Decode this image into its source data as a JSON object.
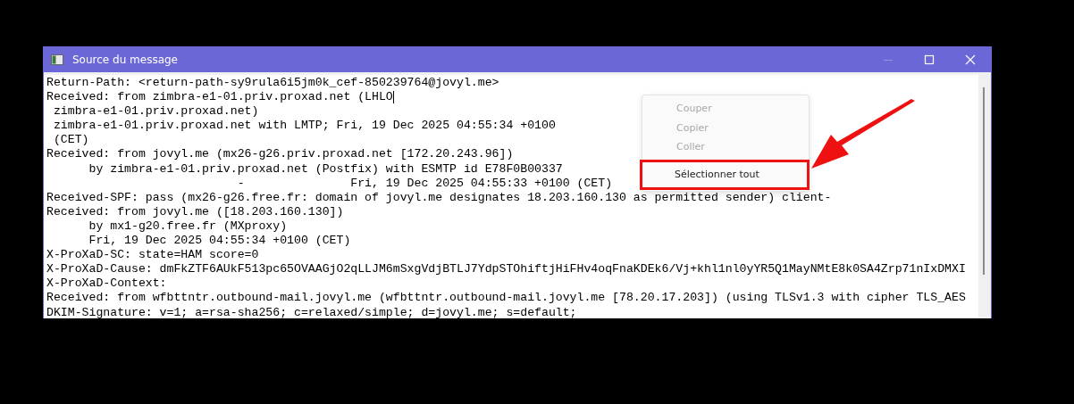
{
  "window": {
    "title": "Source du message"
  },
  "lines": [
    {
      "text": "Return-Path: <return-path-sy9rula6i5jm0k_cef-850239764@jovyl.me>",
      "caret": false
    },
    {
      "text": "Received: from zimbra-e1-01.priv.proxad.net (LHLO",
      "caret": true
    },
    {
      "text": " zimbra-e1-01.priv.proxad.net)",
      "caret": false
    },
    {
      "text": " zimbra-e1-01.priv.proxad.net with LMTP; Fri, 19 Dec 2025 04:55:34 +0100",
      "caret": false
    },
    {
      "text": " (CET)",
      "caret": false
    },
    {
      "text": "Received: from jovyl.me (mx26-g26.priv.proxad.net [172.20.243.96])",
      "caret": false
    },
    {
      "text": "      by zimbra-e1-01.priv.proxad.net (Postfix) with ESMTP id E78F0B00337",
      "caret": false
    },
    {
      "text": "                           -               Fri, 19 Dec 2025 04:55:33 +0100 (CET)",
      "caret": false
    },
    {
      "text": "Received-SPF: pass (mx26-g26.free.fr: domain of jovyl.me designates 18.203.160.130 as permitted sender) client-",
      "caret": false
    },
    {
      "text": "Received: from jovyl.me ([18.203.160.130])",
      "caret": false
    },
    {
      "text": "      by mx1-g20.free.fr (MXproxy)",
      "caret": false
    },
    {
      "text": "      Fri, 19 Dec 2025 04:55:34 +0100 (CET)",
      "caret": false
    },
    {
      "text": "X-ProXaD-SC: state=HAM score=0",
      "caret": false
    },
    {
      "text": "X-ProXaD-Cause: dmFkZTF6AUkF513pc65OVAAGjO2qLLJM6mSxgVdjBTLJ7YdpSTOhiftjHiFHv4oqFnaKDEk6/Vj+khl1nl0yYR5Q1MayNMtE8k0SA4Zrp71nIxDMXI",
      "caret": false
    },
    {
      "text": "X-ProXaD-Context:",
      "caret": false
    },
    {
      "text": "Received: from wfbttntr.outbound-mail.jovyl.me (wfbttntr.outbound-mail.jovyl.me [78.20.17.203]) (using TLSv1.3 with cipher TLS_AES",
      "caret": false
    },
    {
      "text": "DKIM-Signature: v=1; a=rsa-sha256; c=relaxed/simple; d=jovyl.me; s=default;",
      "caret": false
    }
  ],
  "context_menu": {
    "items": [
      {
        "label": "Couper",
        "disabled": true,
        "highlighted": false
      },
      {
        "label": "Copier",
        "disabled": true,
        "highlighted": false
      },
      {
        "label": "Coller",
        "disabled": true,
        "highlighted": false
      },
      {
        "label": "Sélectionner tout",
        "disabled": false,
        "highlighted": true
      }
    ]
  }
}
